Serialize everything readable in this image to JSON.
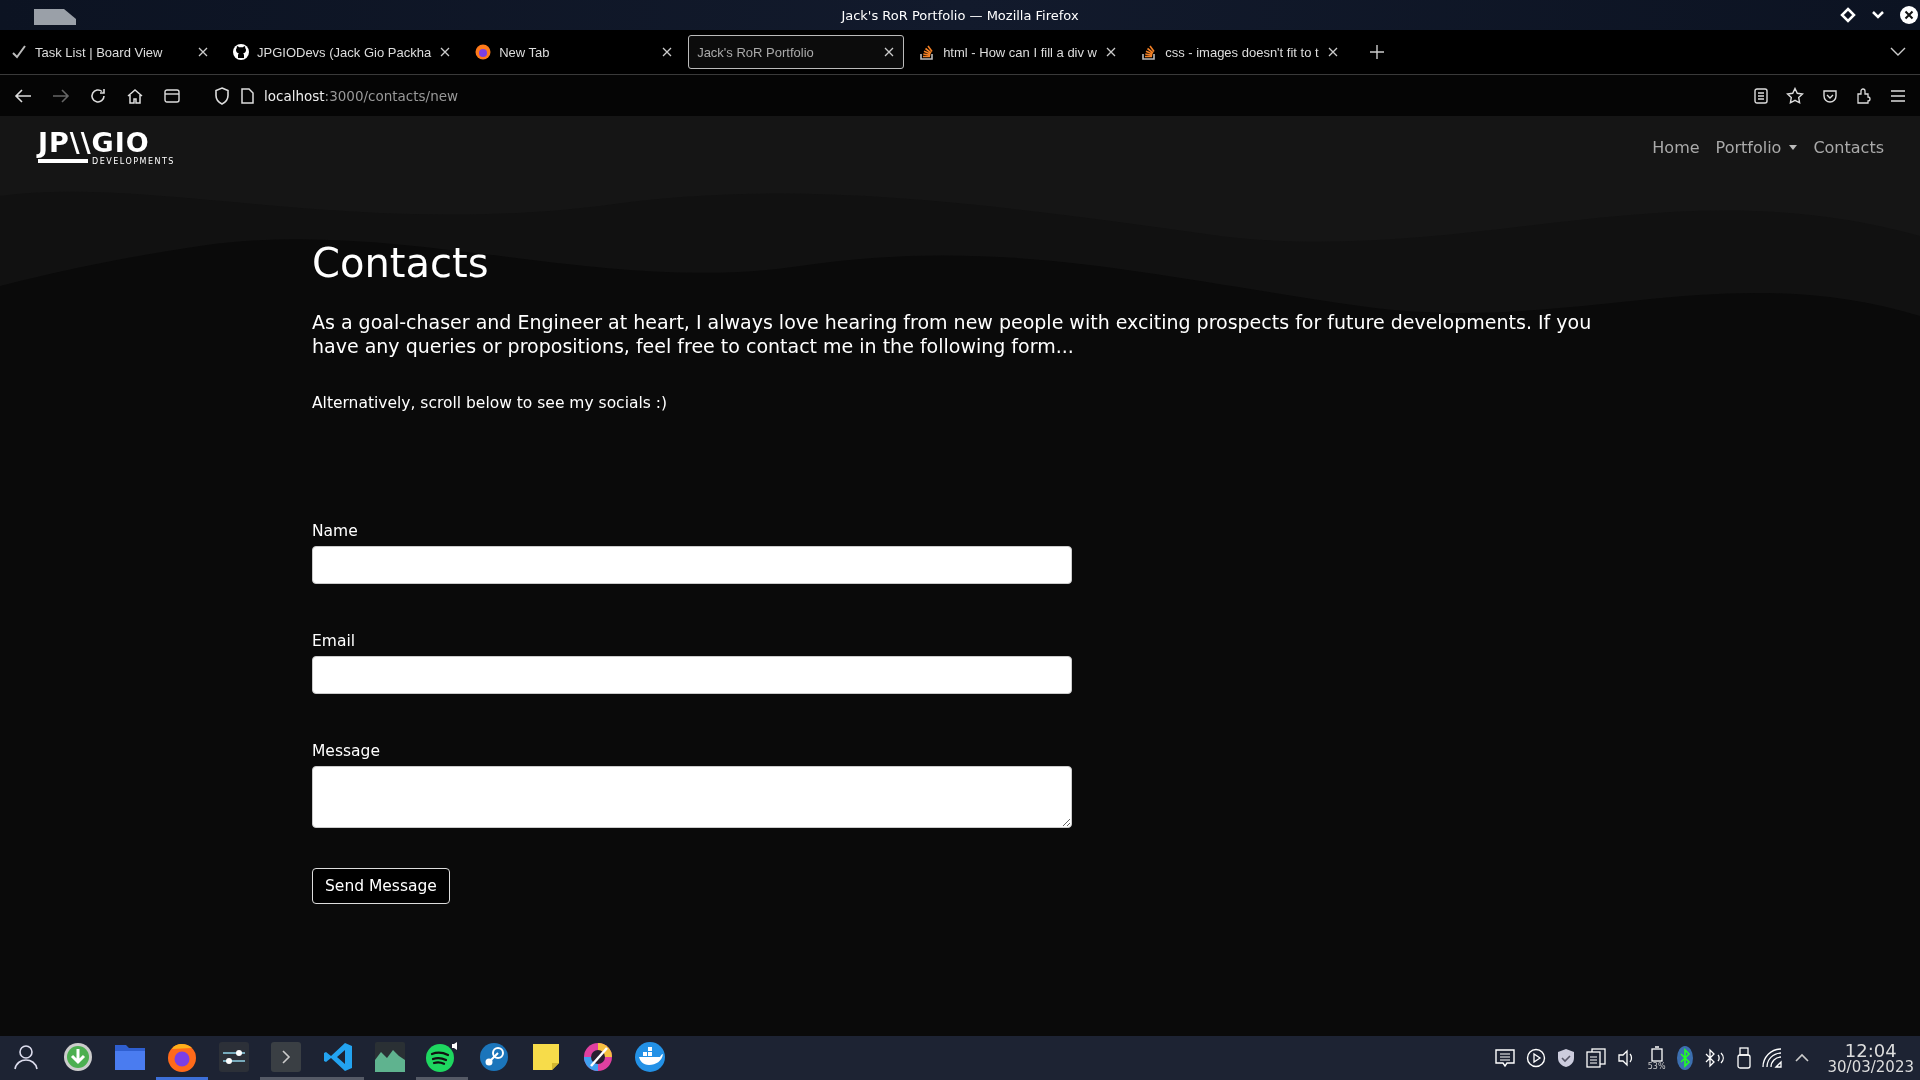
{
  "window": {
    "title": "Jack's RoR Portfolio — Mozilla Firefox"
  },
  "tabs": [
    {
      "label": "Task List | Board View",
      "selected": false
    },
    {
      "label": "JPGIODevs (Jack Gio Packha",
      "selected": false
    },
    {
      "label": "New Tab",
      "selected": false
    },
    {
      "label": "Jack's RoR Portfolio",
      "selected": true
    },
    {
      "label": "html - How can I fill a div w",
      "selected": false
    },
    {
      "label": "css - images doesn't fit to t",
      "selected": false
    }
  ],
  "address_bar": {
    "host": "localhost",
    "path": ":3000/contacts/new"
  },
  "site": {
    "logo": {
      "text": "JP\\\\GIO",
      "subtitle": "DEVELOPMENTS"
    },
    "nav": [
      {
        "label": "Home",
        "dropdown": false
      },
      {
        "label": "Portfolio",
        "dropdown": true
      },
      {
        "label": "Contacts",
        "dropdown": false
      }
    ]
  },
  "heading": "Contacts",
  "intro": "As a goal-chaser and Engineer at heart, I always love hearing from new people with exciting prospects for future developments. If you have any queries or propositions, feel free to contact me in the following form...",
  "note": "Alternatively, scroll below to see my socials :)",
  "form": {
    "fields": [
      {
        "label": "Name",
        "kind": "input"
      },
      {
        "label": "Email",
        "kind": "input"
      },
      {
        "label": "Message",
        "kind": "textarea"
      }
    ],
    "submit": "Send Message"
  },
  "taskbar": {
    "apps": [
      {
        "selected": false,
        "running": false
      },
      {
        "selected": false,
        "running": false
      },
      {
        "selected": false,
        "running": false
      },
      {
        "selected": true,
        "running": true
      },
      {
        "selected": false,
        "running": false
      },
      {
        "selected": false,
        "running": true
      },
      {
        "selected": false,
        "running": true
      },
      {
        "selected": false,
        "running": false
      },
      {
        "selected": false,
        "running": true
      },
      {
        "selected": false,
        "running": false
      },
      {
        "selected": false,
        "running": false
      },
      {
        "selected": false,
        "running": false
      },
      {
        "selected": false,
        "running": false
      }
    ],
    "battery": "53%",
    "time": "12:04",
    "date": "30/03/2023"
  }
}
